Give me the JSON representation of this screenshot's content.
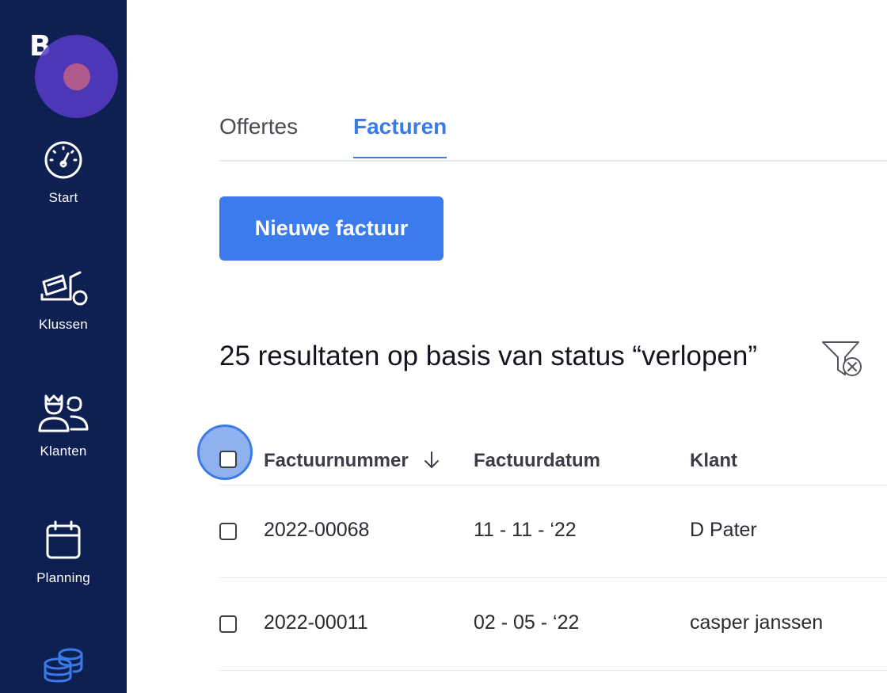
{
  "brand": {
    "logo_text": "B"
  },
  "sidebar": {
    "items": [
      {
        "label": "Start",
        "icon": "dashboard-gauge-icon"
      },
      {
        "label": "Klussen",
        "icon": "cement-mixer-icon"
      },
      {
        "label": "Klanten",
        "icon": "customers-icon"
      },
      {
        "label": "Planning",
        "icon": "calendar-icon"
      },
      {
        "label": "",
        "icon": "coins-database-icon"
      }
    ]
  },
  "tabs": [
    {
      "label": "Offertes",
      "active": false
    },
    {
      "label": "Facturen",
      "active": true
    }
  ],
  "new_invoice_button": "Nieuwe factuur",
  "results_text": "25 resultaten op basis van status “verlopen”",
  "table": {
    "columns": [
      "Factuurnummer",
      "Factuurdatum",
      "Klant"
    ],
    "sort_column": "Factuurnummer",
    "sort_direction": "descending",
    "rows": [
      {
        "number": "2022-00068",
        "date": "11 - 11 - ‘22",
        "client": "D Pater"
      },
      {
        "number": "2022-00011",
        "date": "02 - 05 - ‘22",
        "client": "casper janssen"
      }
    ]
  },
  "colors": {
    "sidebar": "#0e1f52",
    "accent": "#3b7bec",
    "active_tab": "#3a7be6"
  }
}
